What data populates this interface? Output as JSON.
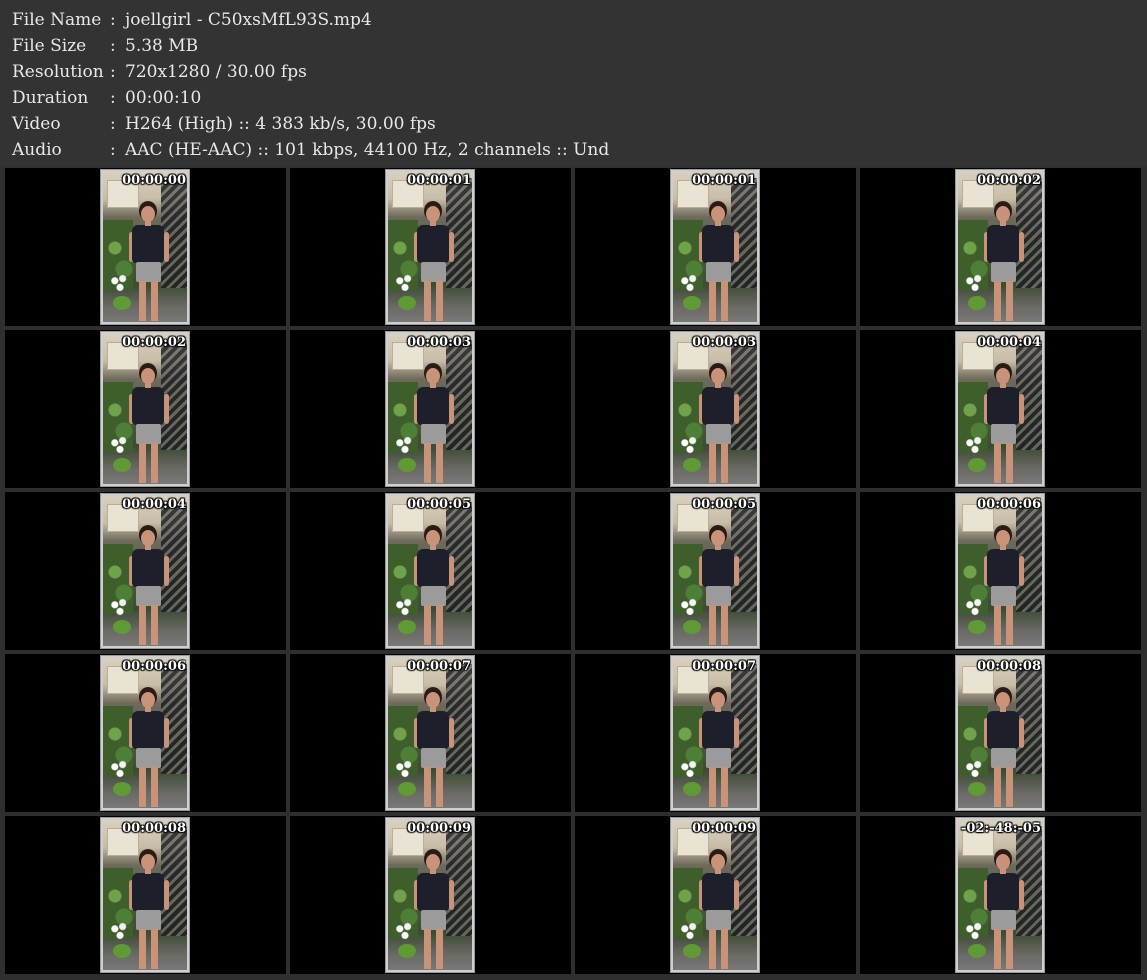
{
  "info": [
    {
      "label": "File Name",
      "value": "joellgirl - C50xsMfL93S.mp4"
    },
    {
      "label": "File Size",
      "value": "5.38 MB"
    },
    {
      "label": "Resolution",
      "value": "720x1280 / 30.00 fps"
    },
    {
      "label": "Duration",
      "value": "00:00:10"
    },
    {
      "label": "Video",
      "value": "H264 (High) :: 4 383 kb/s, 30.00 fps"
    },
    {
      "label": "Audio",
      "value": "AAC (HE-AAC) :: 101 kbps, 44100 Hz, 2 channels :: Und"
    }
  ],
  "separator": ":",
  "thumbnails": [
    "00:00:00",
    "00:00:01",
    "00:00:01",
    "00:00:02",
    "00:00:02",
    "00:00:03",
    "00:00:03",
    "00:00:04",
    "00:00:04",
    "00:00:05",
    "00:00:05",
    "00:00:06",
    "00:00:06",
    "00:00:07",
    "00:00:07",
    "00:00:08",
    "00:00:08",
    "00:00:09",
    "00:00:09",
    "-02:-48:-05"
  ]
}
